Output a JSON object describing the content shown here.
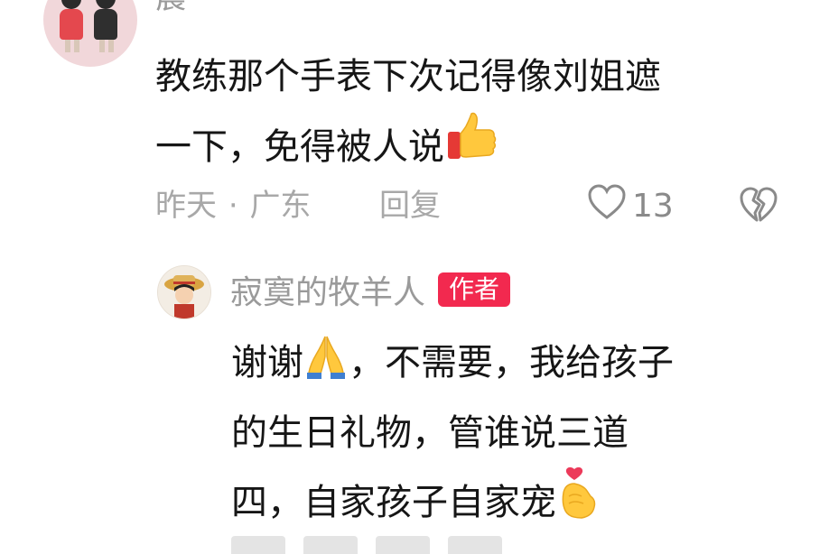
{
  "comment": {
    "author_partial": "晨",
    "text_line1": "教练那个手表下次记得像刘姐遮",
    "text_line2": "一下，免得被人说",
    "emoji": "thumbs-up",
    "meta": {
      "time": "昨天",
      "separator": "·",
      "location": "广东"
    },
    "reply_label": "回复",
    "like_count": "13"
  },
  "reply": {
    "author": "寂寞的牧羊人",
    "badge": "作者",
    "line1_a": "谢谢",
    "line1_b": "，不需要，我给孩子",
    "line2": "的生日礼物，管谁说三道",
    "line3": "四，自家孩子自家宠",
    "emoji_1": "folded-hands",
    "emoji_2": "finger-heart"
  },
  "colors": {
    "meta_gray": "#a8a8a8",
    "badge_red": "#f2294f",
    "text": "#161616"
  }
}
